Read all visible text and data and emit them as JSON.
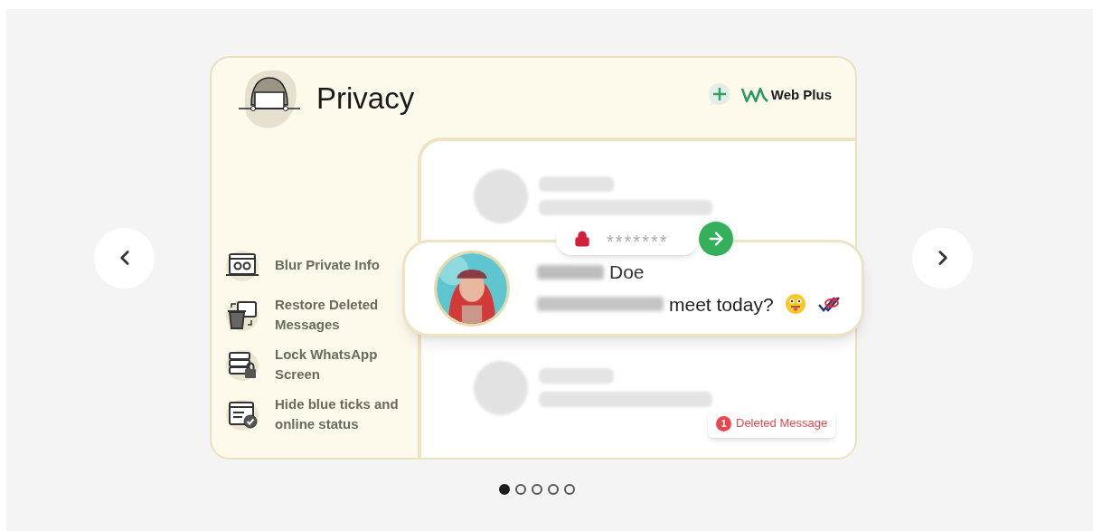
{
  "slide": {
    "title": "Privacy",
    "brand": "Web Plus",
    "features": [
      {
        "kind": "blur",
        "label": "Blur Private Info"
      },
      {
        "kind": "restore",
        "label": "Restore Deleted Messages"
      },
      {
        "kind": "lock",
        "label": "Lock WhatsApp Screen"
      },
      {
        "kind": "ticks",
        "label": "Hide blue ticks and online status"
      }
    ],
    "password_field": {
      "value": "*******"
    },
    "message": {
      "name_visible_part": "Doe",
      "text_visible_part": "meet today?"
    },
    "deleted_badge": {
      "count": "1",
      "label": "Deleted Message"
    }
  },
  "dots": [
    {
      "selected": true
    },
    {
      "selected": false
    },
    {
      "selected": false
    },
    {
      "selected": false
    },
    {
      "selected": false
    }
  ]
}
